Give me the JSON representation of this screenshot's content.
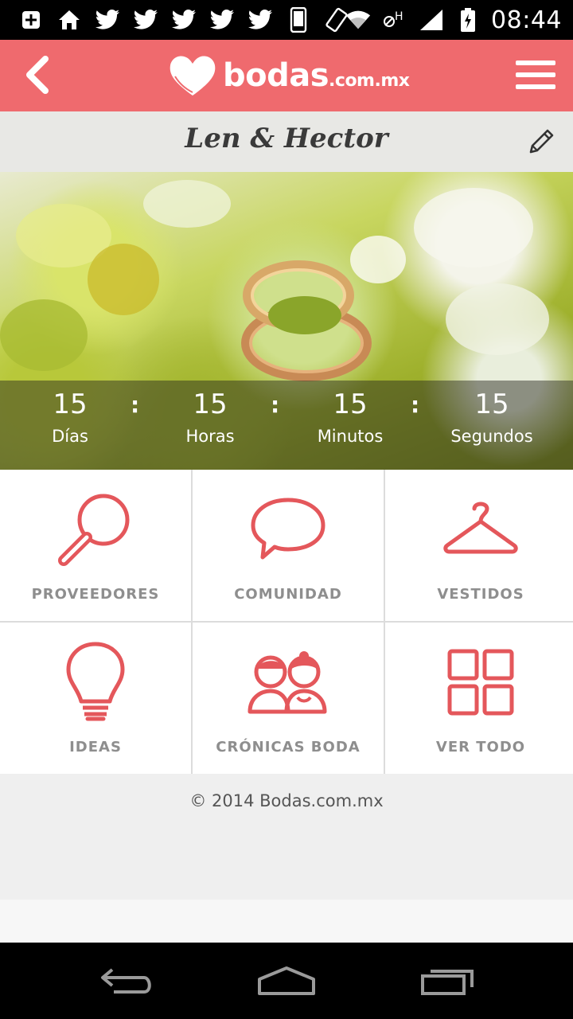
{
  "status_bar": {
    "time": "08:44",
    "left_icons": [
      "add-box-icon",
      "home-icon",
      "twitter-icon",
      "twitter-icon",
      "twitter-icon",
      "twitter-icon",
      "twitter-icon",
      "phone-icon",
      "rotate-icon"
    ],
    "right_icons": [
      "wifi-icon",
      "hplus-icon",
      "signal-icon",
      "battery-icon"
    ],
    "network_type": "H"
  },
  "header": {
    "logo_text": "bodas",
    "logo_domain": ".com.mx",
    "brand_color": "#ef6a6e"
  },
  "couple": {
    "name": "Len & Hector"
  },
  "countdown": {
    "days": "15",
    "days_label": "Días",
    "hours": "15",
    "hours_label": "Horas",
    "minutes": "15",
    "minutes_label": "Minutos",
    "seconds": "15",
    "seconds_label": "Segundos",
    "separator": ":"
  },
  "menu": {
    "accent_color": "#e4575b",
    "items": [
      {
        "label": "PROVEEDORES",
        "icon": "magnifier-icon"
      },
      {
        "label": "COMUNIDAD",
        "icon": "speech-bubble-icon"
      },
      {
        "label": "VESTIDOS",
        "icon": "hanger-icon"
      },
      {
        "label": "IDEAS",
        "icon": "lightbulb-icon"
      },
      {
        "label": "CRÓNICAS BODA",
        "icon": "couple-icon"
      },
      {
        "label": "VER TODO",
        "icon": "grid-icon"
      }
    ]
  },
  "footer": {
    "copyright": "© 2014 Bodas.com.mx"
  },
  "nav": {
    "items": [
      "back-nav-icon",
      "home-nav-icon",
      "recents-nav-icon"
    ]
  }
}
